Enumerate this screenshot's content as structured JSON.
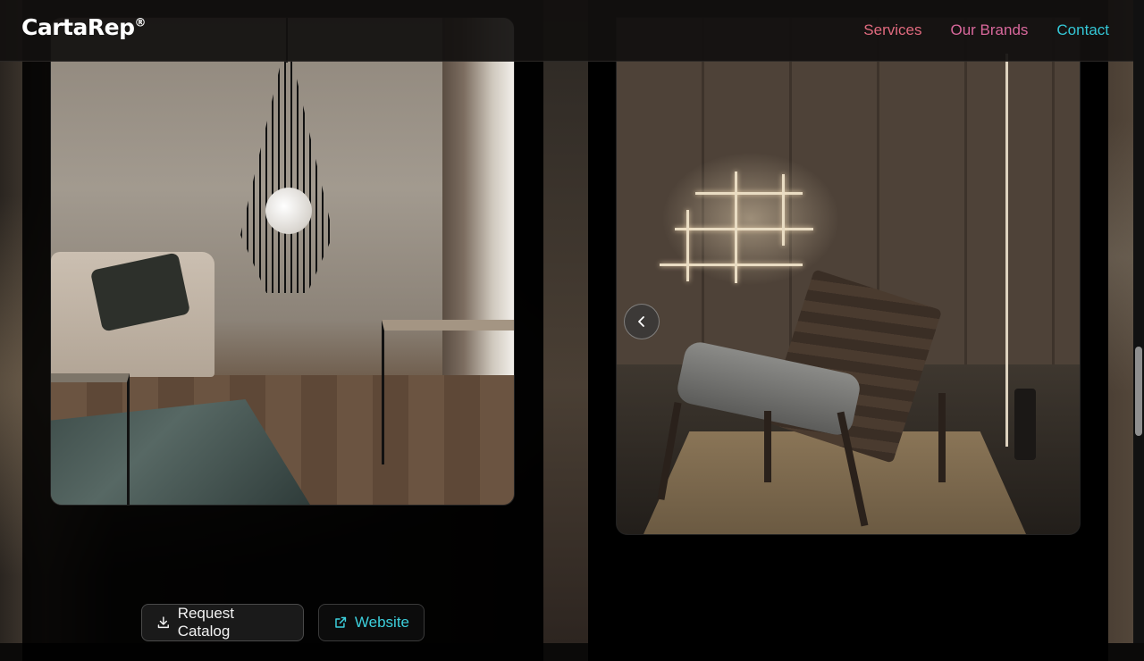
{
  "header": {
    "logo": "CartaRep",
    "logo_mark": "®",
    "nav": [
      "Services",
      "Our Brands",
      "Contact"
    ]
  },
  "carousel": {
    "prev_icon": "chevron-left-icon"
  },
  "actions": {
    "catalog_label": "Request Catalog",
    "catalog_icon": "download-icon",
    "website_label": "Website",
    "website_icon": "external-link-icon"
  },
  "colors": {
    "nav_services": "#e06a7e",
    "nav_brands": "#d9689c",
    "nav_contact": "#34c7d6",
    "website_accent": "#3ccfdc"
  }
}
